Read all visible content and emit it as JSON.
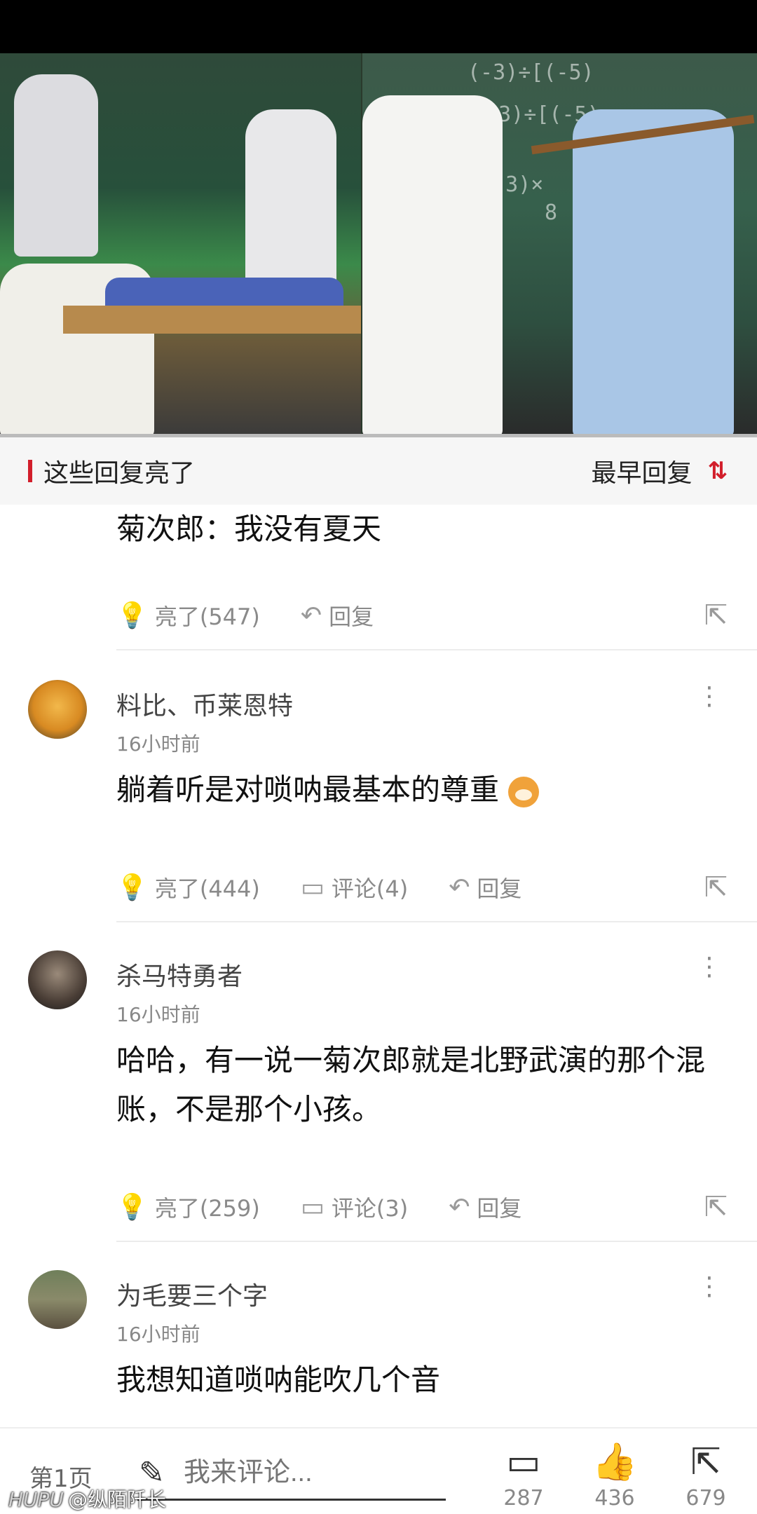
{
  "video": {
    "board_text": [
      "(-3)÷[(-5)",
      "=(-3)÷[(-5)",
      "=(-3)×",
      "8"
    ]
  },
  "reply_header": {
    "title": "这些回复亮了",
    "sort_label": "最早回复",
    "sort_icon": "⇅"
  },
  "partial_comment": {
    "text": "菊次郎：我没有夏天",
    "like_label": "亮了(547)",
    "reply_label": "回复"
  },
  "comments": [
    {
      "username": "料比、币莱恩特",
      "time": "16小时前",
      "text": "躺着听是对唢呐最基本的尊重",
      "like_label": "亮了(444)",
      "comment_label": "评论(4)",
      "reply_label": "回复"
    },
    {
      "username": "杀马特勇者",
      "time": "16小时前",
      "text": "哈哈，有一说一菊次郎就是北野武演的那个混账，不是那个小孩。",
      "like_label": "亮了(259)",
      "comment_label": "评论(3)",
      "reply_label": "回复"
    },
    {
      "username": "为毛要三个字",
      "time": "16小时前",
      "text": "我想知道唢呐能吹几个音"
    }
  ],
  "bottom_bar": {
    "page_label": "第1页",
    "comment_placeholder": "我来评论...",
    "comments_count": "287",
    "likes_count": "436",
    "shares_count": "679"
  },
  "watermark": {
    "brand": "HUPU",
    "handle": "@纵陌阡长"
  },
  "colors": {
    "accent": "#d21e2b",
    "header_bg": "#f6f6f6"
  },
  "icons": [
    "lightbulb-icon",
    "reply-icon",
    "comment-icon",
    "share-icon",
    "more-icon",
    "pen-icon",
    "sort-icon",
    "like-thumb-icon"
  ]
}
